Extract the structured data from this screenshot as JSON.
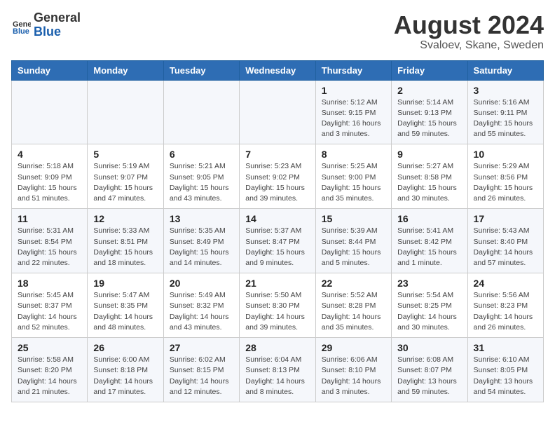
{
  "logo": {
    "general": "General",
    "blue": "Blue"
  },
  "title": "August 2024",
  "subtitle": "Svaloev, Skane, Sweden",
  "days_of_week": [
    "Sunday",
    "Monday",
    "Tuesday",
    "Wednesday",
    "Thursday",
    "Friday",
    "Saturday"
  ],
  "weeks": [
    [
      {
        "day": "",
        "info": ""
      },
      {
        "day": "",
        "info": ""
      },
      {
        "day": "",
        "info": ""
      },
      {
        "day": "",
        "info": ""
      },
      {
        "day": "1",
        "info": "Sunrise: 5:12 AM\nSunset: 9:15 PM\nDaylight: 16 hours and 3 minutes."
      },
      {
        "day": "2",
        "info": "Sunrise: 5:14 AM\nSunset: 9:13 PM\nDaylight: 15 hours and 59 minutes."
      },
      {
        "day": "3",
        "info": "Sunrise: 5:16 AM\nSunset: 9:11 PM\nDaylight: 15 hours and 55 minutes."
      }
    ],
    [
      {
        "day": "4",
        "info": "Sunrise: 5:18 AM\nSunset: 9:09 PM\nDaylight: 15 hours and 51 minutes."
      },
      {
        "day": "5",
        "info": "Sunrise: 5:19 AM\nSunset: 9:07 PM\nDaylight: 15 hours and 47 minutes."
      },
      {
        "day": "6",
        "info": "Sunrise: 5:21 AM\nSunset: 9:05 PM\nDaylight: 15 hours and 43 minutes."
      },
      {
        "day": "7",
        "info": "Sunrise: 5:23 AM\nSunset: 9:02 PM\nDaylight: 15 hours and 39 minutes."
      },
      {
        "day": "8",
        "info": "Sunrise: 5:25 AM\nSunset: 9:00 PM\nDaylight: 15 hours and 35 minutes."
      },
      {
        "day": "9",
        "info": "Sunrise: 5:27 AM\nSunset: 8:58 PM\nDaylight: 15 hours and 30 minutes."
      },
      {
        "day": "10",
        "info": "Sunrise: 5:29 AM\nSunset: 8:56 PM\nDaylight: 15 hours and 26 minutes."
      }
    ],
    [
      {
        "day": "11",
        "info": "Sunrise: 5:31 AM\nSunset: 8:54 PM\nDaylight: 15 hours and 22 minutes."
      },
      {
        "day": "12",
        "info": "Sunrise: 5:33 AM\nSunset: 8:51 PM\nDaylight: 15 hours and 18 minutes."
      },
      {
        "day": "13",
        "info": "Sunrise: 5:35 AM\nSunset: 8:49 PM\nDaylight: 15 hours and 14 minutes."
      },
      {
        "day": "14",
        "info": "Sunrise: 5:37 AM\nSunset: 8:47 PM\nDaylight: 15 hours and 9 minutes."
      },
      {
        "day": "15",
        "info": "Sunrise: 5:39 AM\nSunset: 8:44 PM\nDaylight: 15 hours and 5 minutes."
      },
      {
        "day": "16",
        "info": "Sunrise: 5:41 AM\nSunset: 8:42 PM\nDaylight: 15 hours and 1 minute."
      },
      {
        "day": "17",
        "info": "Sunrise: 5:43 AM\nSunset: 8:40 PM\nDaylight: 14 hours and 57 minutes."
      }
    ],
    [
      {
        "day": "18",
        "info": "Sunrise: 5:45 AM\nSunset: 8:37 PM\nDaylight: 14 hours and 52 minutes."
      },
      {
        "day": "19",
        "info": "Sunrise: 5:47 AM\nSunset: 8:35 PM\nDaylight: 14 hours and 48 minutes."
      },
      {
        "day": "20",
        "info": "Sunrise: 5:49 AM\nSunset: 8:32 PM\nDaylight: 14 hours and 43 minutes."
      },
      {
        "day": "21",
        "info": "Sunrise: 5:50 AM\nSunset: 8:30 PM\nDaylight: 14 hours and 39 minutes."
      },
      {
        "day": "22",
        "info": "Sunrise: 5:52 AM\nSunset: 8:28 PM\nDaylight: 14 hours and 35 minutes."
      },
      {
        "day": "23",
        "info": "Sunrise: 5:54 AM\nSunset: 8:25 PM\nDaylight: 14 hours and 30 minutes."
      },
      {
        "day": "24",
        "info": "Sunrise: 5:56 AM\nSunset: 8:23 PM\nDaylight: 14 hours and 26 minutes."
      }
    ],
    [
      {
        "day": "25",
        "info": "Sunrise: 5:58 AM\nSunset: 8:20 PM\nDaylight: 14 hours and 21 minutes."
      },
      {
        "day": "26",
        "info": "Sunrise: 6:00 AM\nSunset: 8:18 PM\nDaylight: 14 hours and 17 minutes."
      },
      {
        "day": "27",
        "info": "Sunrise: 6:02 AM\nSunset: 8:15 PM\nDaylight: 14 hours and 12 minutes."
      },
      {
        "day": "28",
        "info": "Sunrise: 6:04 AM\nSunset: 8:13 PM\nDaylight: 14 hours and 8 minutes."
      },
      {
        "day": "29",
        "info": "Sunrise: 6:06 AM\nSunset: 8:10 PM\nDaylight: 14 hours and 3 minutes."
      },
      {
        "day": "30",
        "info": "Sunrise: 6:08 AM\nSunset: 8:07 PM\nDaylight: 13 hours and 59 minutes."
      },
      {
        "day": "31",
        "info": "Sunrise: 6:10 AM\nSunset: 8:05 PM\nDaylight: 13 hours and 54 minutes."
      }
    ]
  ]
}
